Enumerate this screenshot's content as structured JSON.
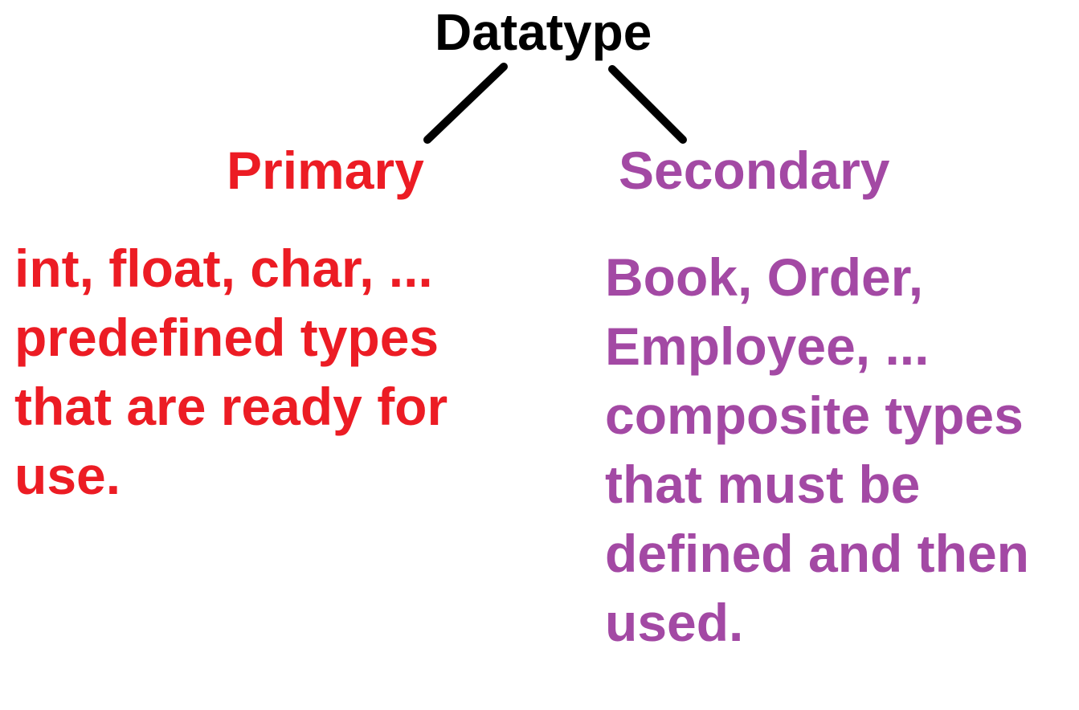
{
  "root": {
    "label": "Datatype",
    "color": "#000000"
  },
  "branches": [
    {
      "label": "Primary",
      "color": "#ec1c24",
      "description": [
        "int, float, char, ...",
        "predefined types",
        "that are ready for",
        "use."
      ]
    },
    {
      "label": "Secondary",
      "color": "#a349a4",
      "description": [
        "Book, Order,",
        "Employee, ...",
        "composite types",
        "that must be",
        "defined and then",
        "used."
      ]
    }
  ],
  "connector_color": "#000000"
}
